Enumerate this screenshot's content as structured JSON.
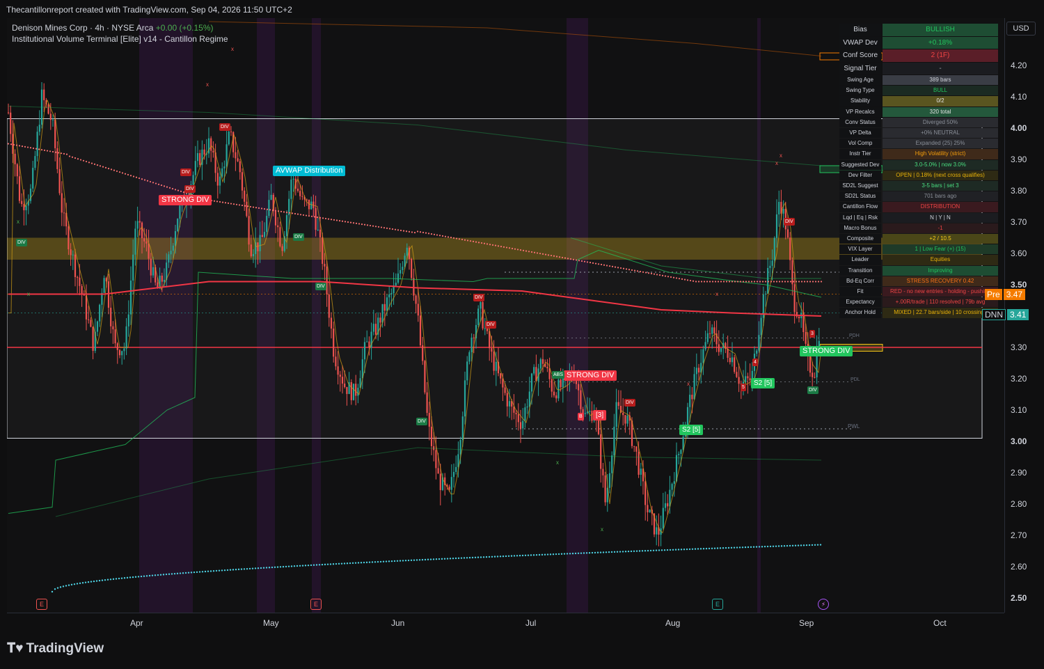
{
  "header": {
    "attribution": "Thecantillonreport created with TradingView.com, Sep 04, 2026 11:50 UTC+2"
  },
  "legend": {
    "symbol_line": "Denison Mines Corp · 4h · NYSE Arca",
    "change": "+0.00 (+0.15%)",
    "indicator": "Institutional Volume Terminal [Elite] v14 - Cantillon Regime"
  },
  "currency_button": "USD",
  "y_axis": {
    "ticks": [
      "4.20",
      "4.10",
      "4.00",
      "3.90",
      "3.80",
      "3.70",
      "3.60",
      "3.50",
      "3.40",
      "3.30",
      "3.20",
      "3.10",
      "3.00",
      "2.90",
      "2.80",
      "2.70",
      "2.60",
      "2.50"
    ],
    "bold_ticks": [
      "4.00",
      "3.50",
      "3.00",
      "2.50"
    ]
  },
  "x_axis": {
    "ticks": [
      "Apr",
      "May",
      "Jun",
      "Jul",
      "Aug",
      "Sep",
      "Oct"
    ]
  },
  "price_tags": {
    "pre_label": "Pre",
    "pre_value": "3.47",
    "sym_label": "DNN",
    "sym_value": "3.41"
  },
  "panel_rows": [
    {
      "k": "Bias",
      "v": "BULLISH",
      "bg": "#1e4d33",
      "fg": "#22c55e",
      "big": true
    },
    {
      "k": "VWAP Dev",
      "v": "+0.18%",
      "bg": "#1e4d33",
      "fg": "#22c55e",
      "big": true
    },
    {
      "k": "Conf Score",
      "v": "2 (1F)",
      "bg": "#5a1e28",
      "fg": "#ef4444",
      "big": true
    },
    {
      "k": "Signal Tier",
      "v": "-",
      "bg": "#1b1c20",
      "fg": "#9aa0aa",
      "big": true
    },
    {
      "k": "Swing Age",
      "v": "389 bars",
      "bg": "#3a3d45",
      "fg": "#d1d4dc"
    },
    {
      "k": "Swing Type",
      "v": "BULL",
      "bg": "#1b2a22",
      "fg": "#22c55e"
    },
    {
      "k": "Stability",
      "v": "0/2",
      "bg": "#5a5520",
      "fg": "#e5e5e5"
    },
    {
      "k": "VP Recalcs",
      "v": "320 total",
      "bg": "#24583c",
      "fg": "#e5e5e5"
    },
    {
      "k": "Conv Status",
      "v": "Diverged 50%",
      "bg": "#2a2b30",
      "fg": "#8a8f98"
    },
    {
      "k": "VP Delta",
      "v": "+0% NEUTRAL",
      "bg": "#2a2b30",
      "fg": "#8a8f98"
    },
    {
      "k": "Vol Comp",
      "v": "Expanded (25) 25%",
      "bg": "#2a2b30",
      "fg": "#8a8f98"
    },
    {
      "k": "Instr Tier",
      "v": "High Volatility (strict)",
      "bg": "#3f2a1a",
      "fg": "#f59e0b"
    },
    {
      "k": "Suggested Dev",
      "v": "3.0-5.0% | now 3.0%",
      "bg": "#1e2a24",
      "fg": "#4ade80"
    },
    {
      "k": "Dev Filter",
      "v": "OPEN | 0.18% (next cross qualifies)",
      "bg": "#2e2a14",
      "fg": "#eab308"
    },
    {
      "k": "SD2L Suggest",
      "v": "3-5 bars | set 3",
      "bg": "#1e2a24",
      "fg": "#4ade80"
    },
    {
      "k": "SD2L Status",
      "v": "701 bars ago",
      "bg": "#202125",
      "fg": "#8a8f98"
    },
    {
      "k": "Cantillon Flow",
      "v": "DISTRIBUTION",
      "bg": "#3a1a1f",
      "fg": "#ef4444"
    },
    {
      "k": "Lqd | Eq | Rsk",
      "v": "N | Y | N",
      "bg": "#1b1c20",
      "fg": "#d1d4dc"
    },
    {
      "k": "Macro Bonus",
      "v": "-1",
      "bg": "#2a1a1c",
      "fg": "#ef4444"
    },
    {
      "k": "Composite",
      "v": "+2 / 10.5",
      "bg": "#4a4618",
      "fg": "#facc15"
    },
    {
      "k": "VIX Layer",
      "v": "1 | Low Fear (+) (15)",
      "bg": "#1e3a28",
      "fg": "#22c55e"
    },
    {
      "k": "Leader",
      "v": "Equities",
      "bg": "#2e2a14",
      "fg": "#eab308"
    },
    {
      "k": "Transition",
      "v": "Improving",
      "bg": "#1e4d33",
      "fg": "#22c55e"
    },
    {
      "k": "Bd-Eq Corr",
      "v": "STRESS RECOVERY 0.42",
      "bg": "#3f2a1a",
      "fg": "#f97316"
    },
    {
      "k": "Fit",
      "v": "RED - no new entries - holding - pushing",
      "bg": "#3a1a1f",
      "fg": "#ef4444"
    },
    {
      "k": "Expectancy",
      "v": "+.00R/trade | 110 resolved | 79b avg",
      "bg": "#2a1a1c",
      "fg": "#ef4444"
    },
    {
      "k": "Anchor Hold",
      "v": "MIXED | 22.7 bars/side | 10 crossings",
      "bg": "#2e2a14",
      "fg": "#eab308"
    }
  ],
  "chart_labels": {
    "avwap_tag": "AVWAP Distribution",
    "strong_div_left": "STRONG DIV",
    "strong_div_mid": "STRONG DIV",
    "strong_div_right": "STRONG DIV",
    "s2_mid": "S2 [5]",
    "s2_right": "S2 [5]",
    "bracket_3": "[3]",
    "pdh": "PDH",
    "pdl": "PDL",
    "pwl": "PWL",
    "div": "DIV",
    "abs": "ABS",
    "b": "B",
    "num3": "3",
    "num4": "4",
    "num5": "5",
    "x": "x",
    "event_e": "E"
  },
  "colors": {
    "up": "#26a69a",
    "down": "#ef5350",
    "vwap": "#f23645",
    "cyan": "#4dd0e1",
    "sar": "#f87171",
    "band": "#f5c518",
    "session": "#7b1fa2"
  },
  "footer": {
    "brand": "TradingView"
  }
}
